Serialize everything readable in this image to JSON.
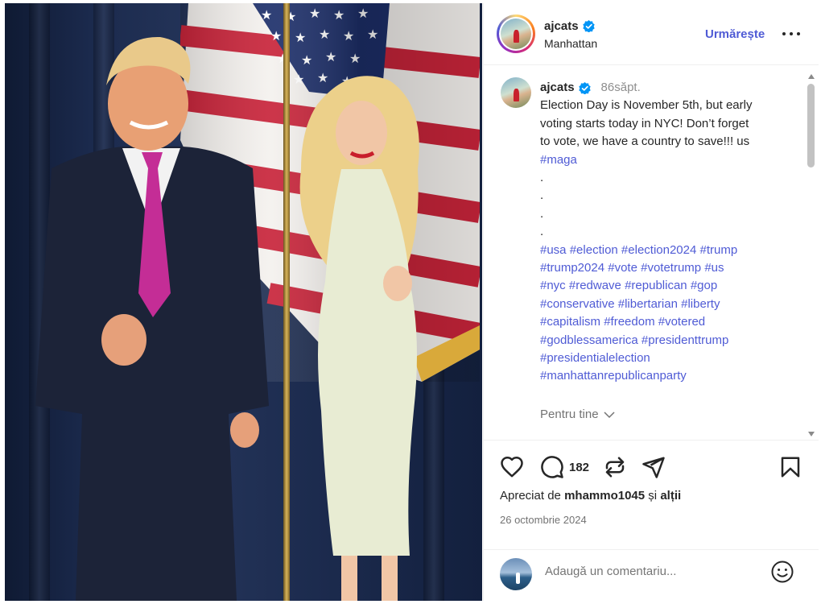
{
  "post": {
    "username": "ajcats",
    "location": "Manhattan",
    "follow_label": "Urmărește",
    "more_label": "Mai multe opțiuni"
  },
  "caption": {
    "username": "ajcats",
    "time_ago": "86săpt.",
    "lines": [
      "Election Day is November 5th, but early",
      "voting starts today in NYC! Don’t forget",
      "to vote, we have a country to save!!! us"
    ],
    "first_tag": "#maga",
    "dots": [
      ".",
      ".",
      ".",
      "."
    ],
    "hashtag_lines": [
      [
        "#usa",
        "#election",
        "#election2024",
        "#trump"
      ],
      [
        "#trump2024",
        "#vote",
        "#votetrump",
        "#us"
      ],
      [
        "#nyc",
        "#redwave",
        "#republican",
        "#gop"
      ],
      [
        "#conservative",
        "#libertarian",
        "#liberty"
      ],
      [
        "#capitalism",
        "#freedom",
        "#votered"
      ],
      [
        "#godblessamerica",
        "#presidenttrump"
      ],
      [
        "#presidentialelection"
      ],
      [
        "#manhattanrepublicanparty"
      ]
    ],
    "for_you": "Pentru tine"
  },
  "actions": {
    "like_icon": "heart-icon",
    "comment_icon": "comment-icon",
    "comment_count": "182",
    "repost_icon": "repost-icon",
    "share_icon": "share-icon",
    "save_icon": "bookmark-icon"
  },
  "likes": {
    "prefix": "Apreciat de",
    "user": "mhammo1045",
    "connector": "și",
    "suffix": "alții"
  },
  "date": "26 octombrie 2024",
  "comment": {
    "placeholder": "Adaugă un comentariu..."
  },
  "colors": {
    "link_blue": "#4f5bd5",
    "verified_blue": "#0095f6",
    "muted": "#737373"
  }
}
